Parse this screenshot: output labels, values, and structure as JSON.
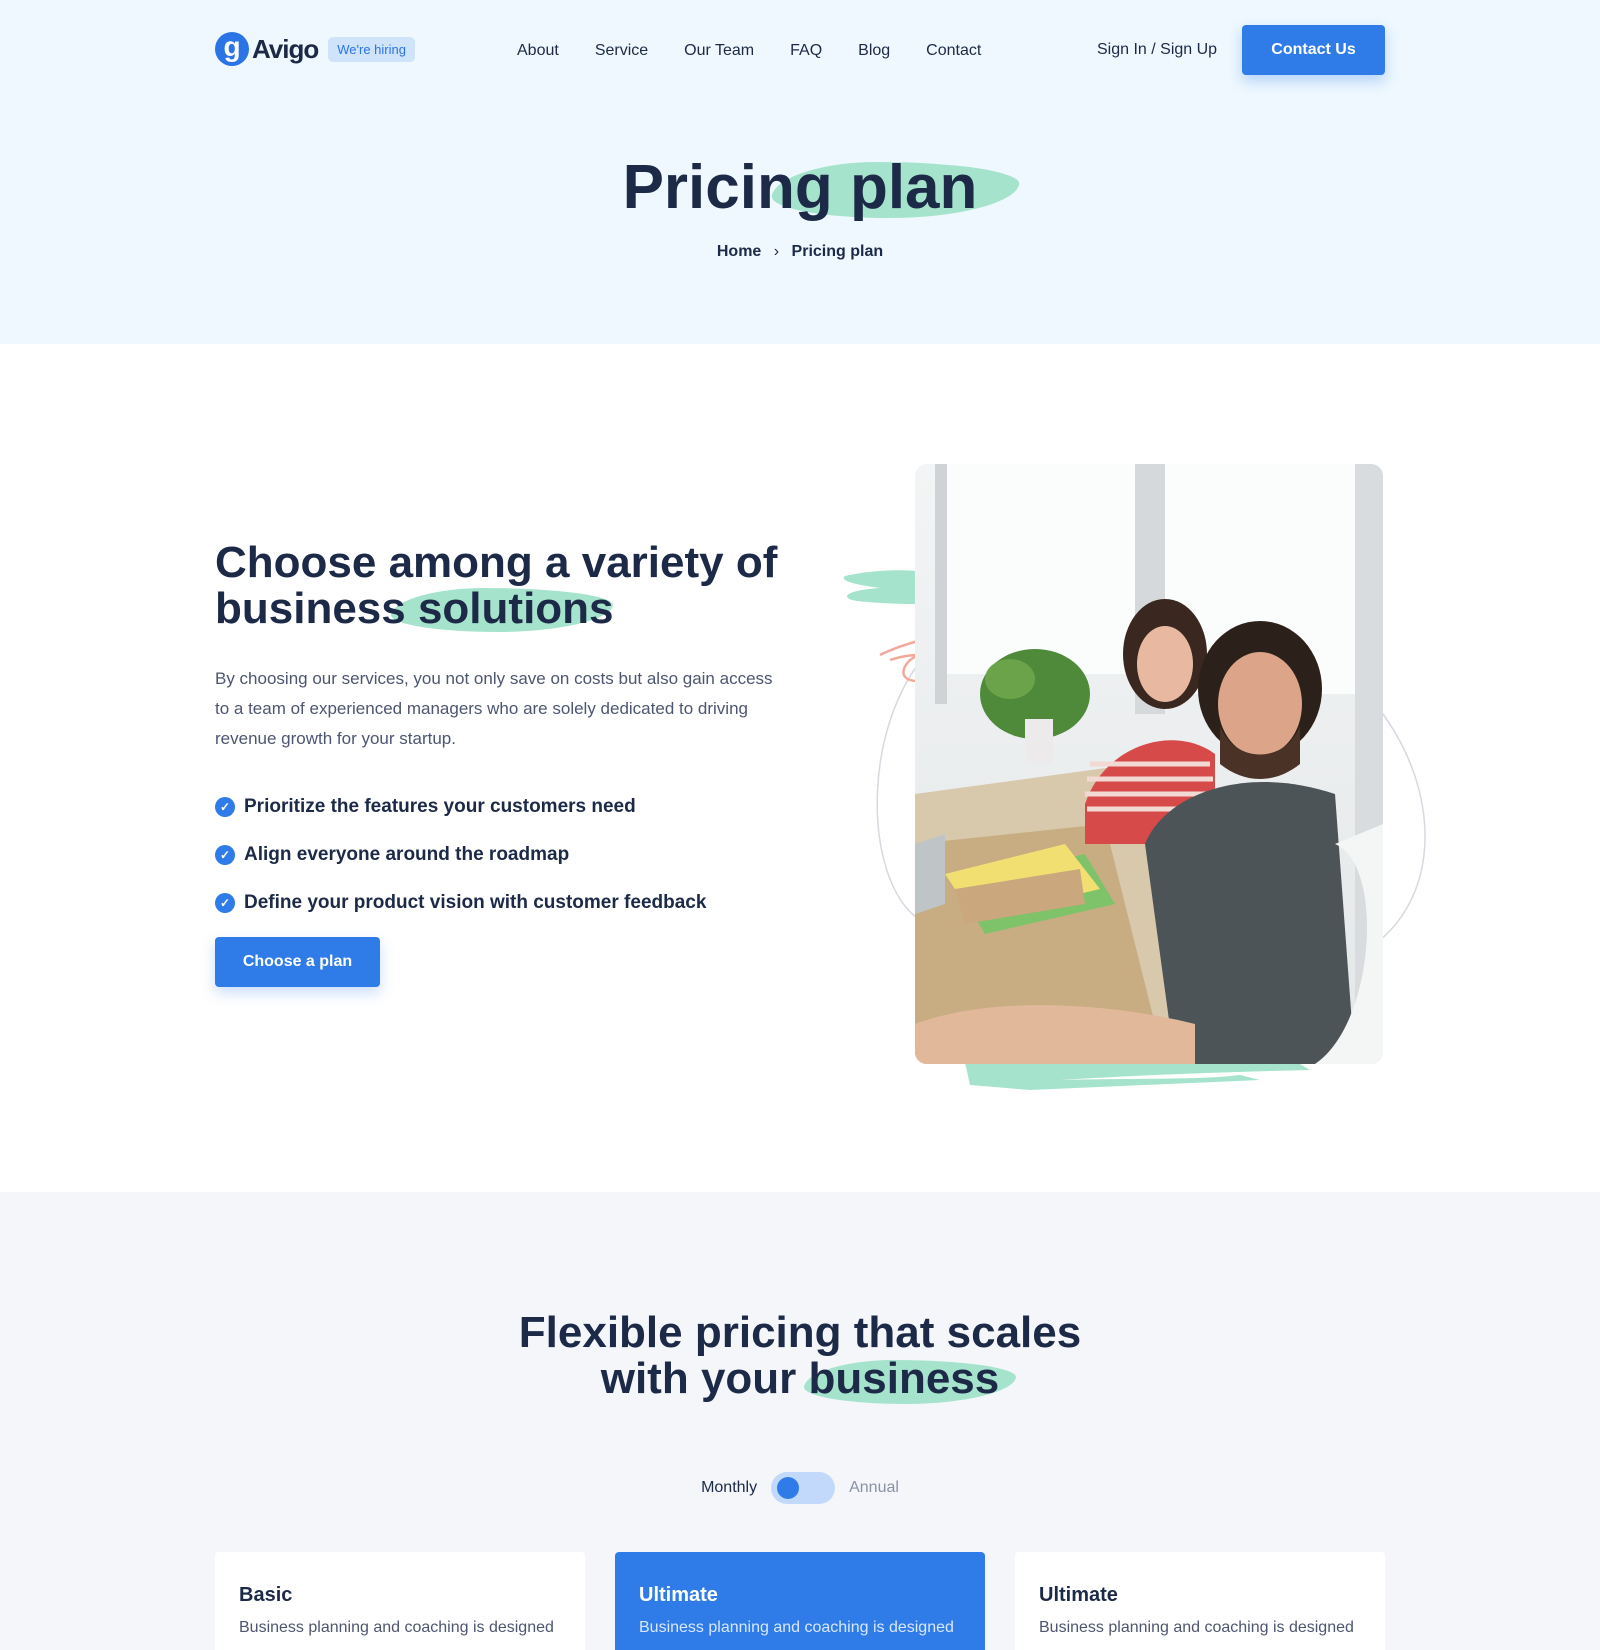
{
  "brand": {
    "logo_letter": "g",
    "name": "Avigo",
    "hiring_badge": "We're hiring"
  },
  "nav": {
    "items": [
      "About",
      "Service",
      "Our Team",
      "FAQ",
      "Blog",
      "Contact"
    ]
  },
  "header": {
    "signin": "Sign In / Sign Up",
    "contact_button": "Contact Us"
  },
  "hero": {
    "title": "Pricing plan",
    "breadcrumb": {
      "home": "Home",
      "separator": "›",
      "current": "Pricing plan"
    }
  },
  "intro": {
    "title_line1": "Choose among a variety of",
    "title_line2": "business solutions",
    "description": "By choosing our services, you not only save on costs but also gain access to a team of experienced managers who are solely dedicated to driving revenue growth for your startup.",
    "features": [
      "Prioritize the features your customers need",
      "Align everyone around the roadmap",
      "Define your product vision with customer feedback"
    ],
    "cta": "Choose a plan"
  },
  "pricing": {
    "title_line1": "Flexible pricing that scales",
    "title_line2": "with your business",
    "toggle": {
      "left": "Monthly",
      "right": "Annual",
      "selected": "Monthly"
    },
    "plans": [
      {
        "name": "Basic",
        "desc": "Business planning and coaching is designed",
        "featured": false
      },
      {
        "name": "Ultimate",
        "desc": "Business planning and coaching is designed",
        "featured": true
      },
      {
        "name": "Ultimate",
        "desc": "Business planning and coaching is designed",
        "featured": false
      }
    ]
  },
  "colors": {
    "accent": "#2f7ce8",
    "highlight": "#a6e3cc",
    "hero_bg": "#eef8fe",
    "text": "#1c2a48"
  }
}
